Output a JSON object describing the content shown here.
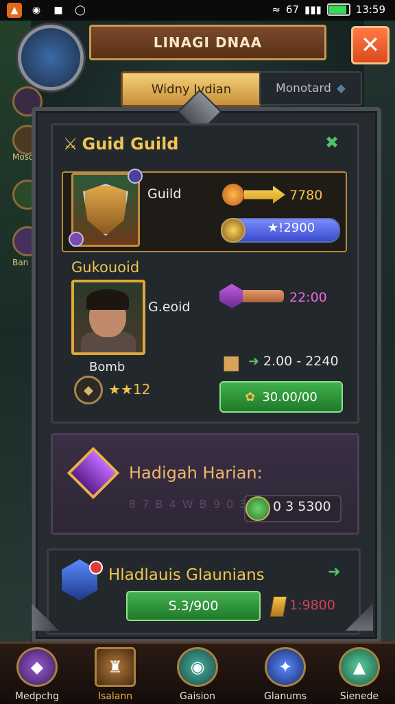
{
  "status_bar": {
    "time": "13:59",
    "network": "67",
    "icons": [
      "app-icon",
      "camera-icon",
      "notification-icon",
      "location-icon",
      "wifi-icon",
      "signal-icon",
      "battery-icon"
    ],
    "battery_level": 0.95
  },
  "header": {
    "title": "LINAGI DNAA",
    "close_icon": "close-icon"
  },
  "tabs": [
    {
      "label": "Widny Ivdian",
      "active": true
    },
    {
      "label": "Monotard",
      "active": false
    }
  ],
  "side_menu": {
    "left_labels": [
      "Moso",
      "Ban"
    ]
  },
  "section_guild": {
    "title": "Guid Guild",
    "guild_label": "Guild",
    "arrow_value": "7780",
    "bar_value": "★⁡2900",
    "bar_text": "★!2900",
    "hero_title": "Gukouoid",
    "hero_label": "G.eoid",
    "hero_caption": "Bomb",
    "stars_text": "★★12",
    "purple_value": "22:00",
    "resource_value": "2.00 - 2240",
    "button_label": "30.00/00"
  },
  "section_relic": {
    "title": "Hadigah Harian:",
    "faint_text": "8 7 B 4 W B 9 0 3",
    "value": "0 3 5300"
  },
  "section_bottom": {
    "title": "Hladlauis Glaunians",
    "button_label": "S.3/900",
    "value": "1:9800"
  },
  "bottom_nav": [
    {
      "label": "Medpchg",
      "active": false
    },
    {
      "label": "Isalann",
      "active": true
    },
    {
      "label": "Gaision",
      "active": false
    },
    {
      "label": "Glanums",
      "active": false
    },
    {
      "label": "Sienede",
      "active": false
    }
  ],
  "colors": {
    "gold": "#f0c552",
    "green_button": "#3fb04a",
    "close_button": "#e95a2a",
    "purple_panel": "#3a2f44"
  }
}
